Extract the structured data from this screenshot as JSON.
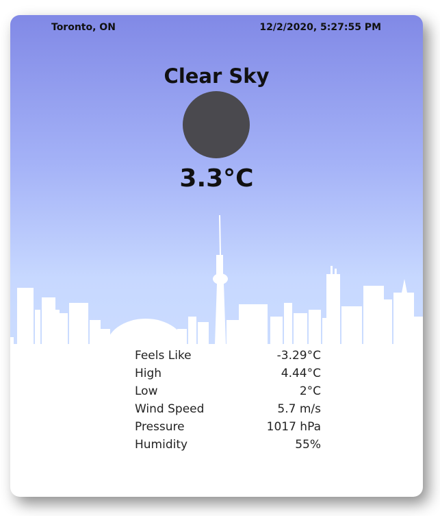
{
  "header": {
    "location": "Toronto, ON",
    "datetime": "12/2/2020, 5:27:55 PM"
  },
  "weather": {
    "condition": "Clear Sky",
    "temperature": "3.3°C",
    "icon": "moon-icon"
  },
  "details": [
    {
      "label": "Feels Like",
      "value": "-3.29°C"
    },
    {
      "label": "High",
      "value": "4.44°C"
    },
    {
      "label": "Low",
      "value": "2°C"
    },
    {
      "label": "Wind Speed",
      "value": "5.7 m/s"
    },
    {
      "label": "Pressure",
      "value": "1017 hPa"
    },
    {
      "label": "Humidity",
      "value": "55%"
    }
  ],
  "colors": {
    "sky_top": "#8189e6",
    "sky_bottom": "#cbdcff",
    "icon_fill": "#4a494e"
  }
}
